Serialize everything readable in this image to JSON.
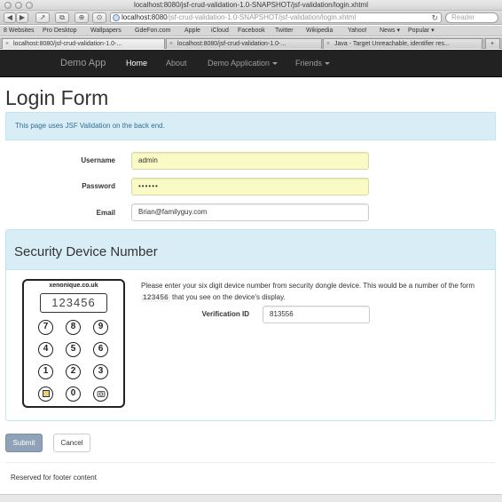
{
  "browser": {
    "window_title": "localhost:8080/jsf-crud-validation-1.0-SNAPSHOT/jsf-validation/login.xhtml",
    "url_host": "localhost:8080",
    "url_path": "/jsf-crud-validation-1.0-SNAPSHOT/jsf-validation/login.xhtml",
    "search_placeholder": "Reader",
    "toolbar_buttons": [
      "◀",
      "▶",
      "↗",
      "⧉",
      "⊕",
      "⊙"
    ],
    "bookmarks": [
      "8 Websites",
      "Pro Desktop",
      "Wallpapers",
      "GdeFon.com",
      "Apple",
      "iCloud",
      "Facebook",
      "Twitter",
      "Wikipedia",
      "Yahoo!",
      "News ▾",
      "Popular ▾"
    ],
    "tabs": [
      "localhost:8080/jsf-crud-validation-1.0-...",
      "localhost:8080/jsf-crud-validation-1.0-...",
      "Java - Target Unreachable, identifier res..."
    ],
    "tab_plus": "+"
  },
  "navbar": {
    "brand": "Demo App",
    "items": [
      "Home",
      "About",
      "Demo Application",
      "Friends"
    ]
  },
  "form": {
    "title": "Login Form",
    "info": "This page uses JSF Validation on the back end.",
    "username_label": "Username",
    "username_value": "admin",
    "password_label": "Password",
    "password_value": "••••••",
    "email_label": "Email",
    "email_value": "Brian@familyguy.com"
  },
  "security": {
    "title": "Security Device Number",
    "help_before": "Please enter your six digit device number from security dongle device. This would be a number of the form",
    "help_code": "123456",
    "help_after": "that you see on the device's display.",
    "verification_label": "Verification ID",
    "verification_value": "813556",
    "device_site": "xenonique.co.uk",
    "device_display": "123456",
    "keys": [
      "7",
      "8",
      "9",
      "4",
      "5",
      "6",
      "1",
      "2",
      "3",
      "",
      "0",
      ""
    ]
  },
  "actions": {
    "submit": "Submit",
    "cancel": "Cancel"
  },
  "footer": {
    "text": "Reserved for footer content"
  }
}
